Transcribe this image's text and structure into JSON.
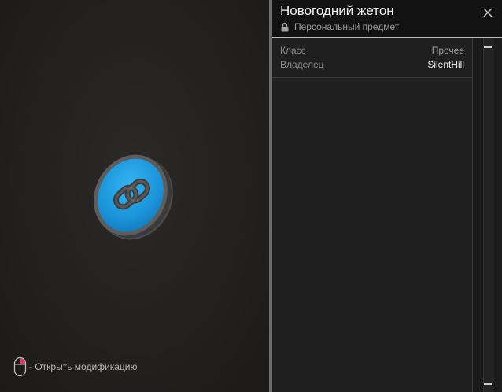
{
  "item": {
    "title": "Новогодний жетон",
    "subtitle": "Персональный предмет",
    "icon": "chain-link-icon",
    "accent_color": "#1e9be3"
  },
  "properties": [
    {
      "label": "Класс",
      "value": "Прочее"
    },
    {
      "label": "Владелец",
      "value": "SilentHill"
    }
  ],
  "viewport": {
    "hint_text": "- Открыть модификацию",
    "hint_icon": "mouse-right-click-icon"
  },
  "icons": {
    "close": "close-icon",
    "lock": "lock-icon"
  }
}
